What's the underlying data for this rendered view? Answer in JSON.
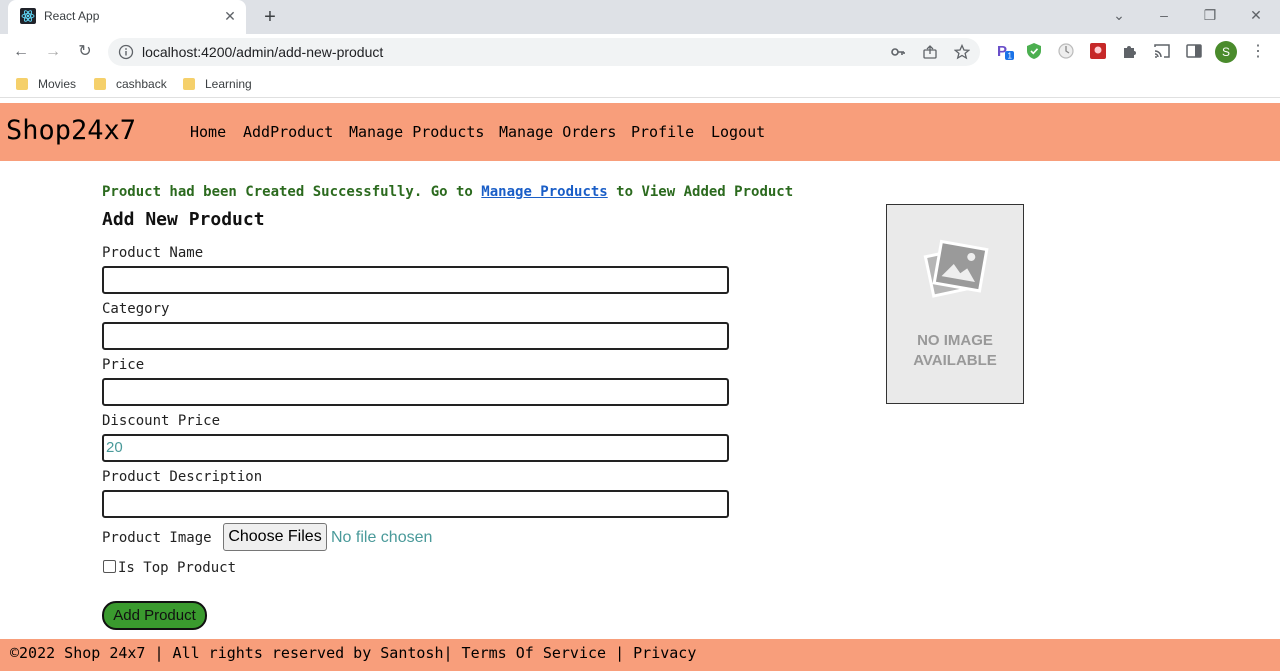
{
  "browser": {
    "tab_title": "React App",
    "new_tab": "+",
    "url": "localhost:4200/admin/add-new-product",
    "profile_initial": "S",
    "bookmarks": [
      "Movies",
      "cashback",
      "Learning"
    ],
    "extension_badge": "1"
  },
  "app": {
    "brand": "Shop24x7",
    "nav": [
      "Home",
      "AddProduct",
      "Manage Products",
      "Manage Orders",
      "Profile",
      "Logout"
    ],
    "success": {
      "prefix": "Product had been Created Successfully. Go to ",
      "link": "Manage Products",
      "suffix": " to View Added Product"
    },
    "form": {
      "title": "Add New Product",
      "product_name_label": "Product Name",
      "product_name_value": "",
      "category_label": "Category",
      "category_value": "",
      "price_label": "Price",
      "price_value": "",
      "discount_label": "Discount Price",
      "discount_value": "20",
      "description_label": "Product Description",
      "description_value": "",
      "image_label": "Product Image",
      "choose_files": "Choose Files",
      "file_status": "No file chosen",
      "top_product_label": "Is Top Product",
      "submit": "Add Product"
    },
    "preview": {
      "line1": "NO IMAGE",
      "line2": "AVAILABLE"
    },
    "footer": {
      "copyright": "©2022 Shop 24x7 | All rights reserved by Santosh",
      "terms": "Terms Of Service",
      "privacy": "Privacy"
    }
  },
  "colors": {
    "accent": "#f89e7b",
    "success_text": "#2b6a1e",
    "link": "#1a5ec7",
    "button_green": "#3a9a2e"
  }
}
